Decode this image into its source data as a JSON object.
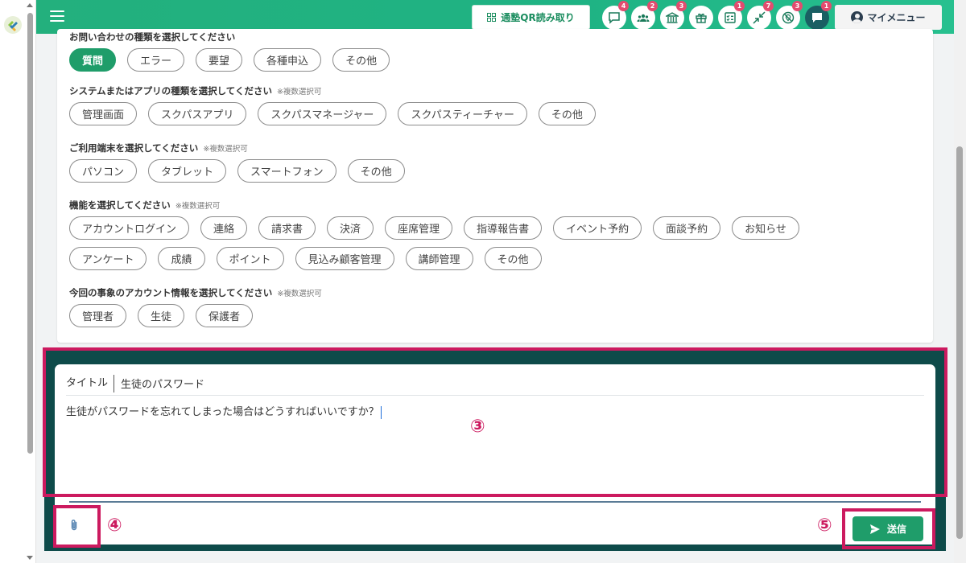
{
  "header": {
    "qr_button_label": "通塾QR読み取り",
    "icons": [
      {
        "name": "chat-icon",
        "badge": "4"
      },
      {
        "name": "group-icon",
        "badge": "2"
      },
      {
        "name": "school-icon",
        "badge": "3"
      },
      {
        "name": "gift-icon",
        "badge": ""
      },
      {
        "name": "checklist-icon",
        "badge": "1"
      },
      {
        "name": "shrink-arrows-icon",
        "badge": "7"
      },
      {
        "name": "no-location-icon",
        "badge": "3"
      },
      {
        "name": "message-icon",
        "badge": "1"
      }
    ],
    "my_menu_label": "マイメニュー"
  },
  "form": {
    "sections": [
      {
        "label": "お問い合わせの種類を選択してください",
        "note": "",
        "rows": [
          [
            "質問",
            "エラー",
            "要望",
            "各種申込",
            "その他"
          ]
        ],
        "selected": [
          "質問"
        ]
      },
      {
        "label": "システムまたはアプリの種類を選択してください",
        "note": "※複数選択可",
        "rows": [
          [
            "管理画面",
            "スクパスアプリ",
            "スクパスマネージャー",
            "スクパスティーチャー",
            "その他"
          ]
        ],
        "selected": []
      },
      {
        "label": "ご利用端末を選択してください",
        "note": "※複数選択可",
        "rows": [
          [
            "パソコン",
            "タブレット",
            "スマートフォン",
            "その他"
          ]
        ],
        "selected": []
      },
      {
        "label": "機能を選択してください",
        "note": "※複数選択可",
        "rows": [
          [
            "アカウントログイン",
            "連絡",
            "請求書",
            "決済",
            "座席管理",
            "指導報告書",
            "イベント予約",
            "面談予約",
            "お知らせ"
          ],
          [
            "アンケート",
            "成績",
            "ポイント",
            "見込み顧客管理",
            "講師管理",
            "その他"
          ]
        ],
        "selected": []
      },
      {
        "label": "今回の事象のアカウント情報を選択してください",
        "note": "※複数選択可",
        "rows": [
          [
            "管理者",
            "生徒",
            "保護者"
          ]
        ],
        "selected": []
      }
    ]
  },
  "message": {
    "title_label": "タイトル",
    "title_value": "生徒のパスワード",
    "body": "生徒がパスワードを忘れてしまった場合はどうすればいいですか？",
    "send_label": "送信"
  },
  "callouts": {
    "c3": "③",
    "c4": "④",
    "c5": "⑤"
  },
  "colors": {
    "header_green": "#23b07d",
    "primary_green": "#1f9d6a",
    "panel_dark": "#0e4b4a",
    "callout": "#cc1a5f",
    "badge": "#e34b6f"
  }
}
